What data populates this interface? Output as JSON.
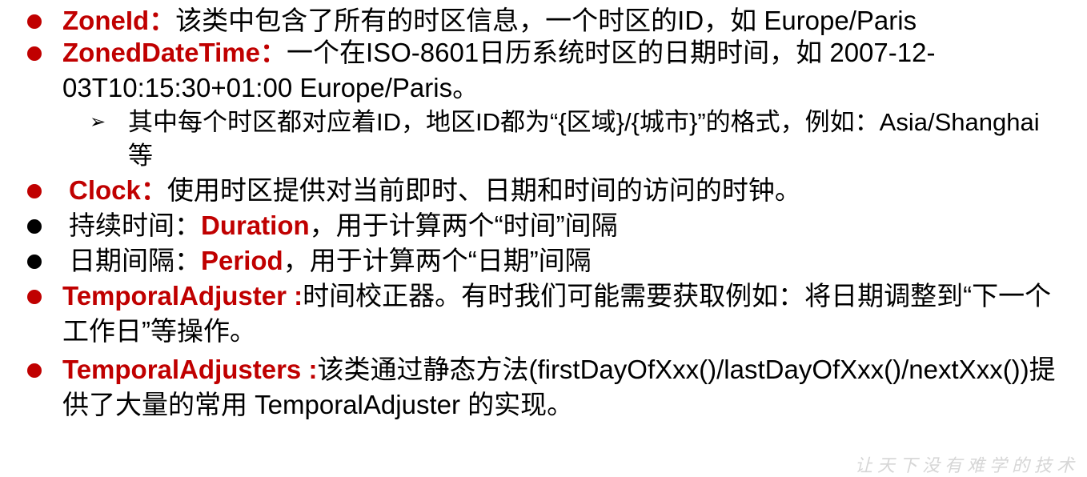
{
  "items": [
    {
      "term": "ZoneId：",
      "text": "该类中包含了所有的时区信息，一个时区的ID，如 Europe/Paris",
      "bullet_color": "#c00000"
    },
    {
      "term": "ZonedDateTime：",
      "text": "一个在ISO-8601日历系统时区的日期时间，如 2007-12-03T10:15:30+01:00 Europe/Paris。",
      "bullet_color": "#c00000",
      "sub": {
        "text": "其中每个时区都对应着ID，地区ID都为“{区域}/{城市}”的格式，例如：Asia/Shanghai等"
      }
    },
    {
      "term": "Clock：",
      "text": "使用时区提供对当前即时、日期和时间的访问的时钟。",
      "bullet_color": "#c00000"
    },
    {
      "prefix": "持续时间：",
      "term": "Duration",
      "text": "，用于计算两个“时间”间隔",
      "bullet_color": "#000000"
    },
    {
      "prefix": "日期间隔：",
      "term": "Period",
      "text": "，用于计算两个“日期”间隔",
      "bullet_color": "#000000"
    },
    {
      "term": "TemporalAdjuster :",
      "text": "时间校正器。有时我们可能需要获取例如：将日期调整到“下一个工作日”等操作。",
      "bullet_color": "#c00000"
    },
    {
      "term": "TemporalAdjusters :",
      "text": "该类通过静态方法(firstDayOfXxx()/lastDayOfXxx()/nextXxx())提供了大量的常用 TemporalAdjuster 的实现。",
      "bullet_color": "#c00000"
    }
  ],
  "accent_color": "#c00000",
  "watermark": "让天下没有难学的技术"
}
